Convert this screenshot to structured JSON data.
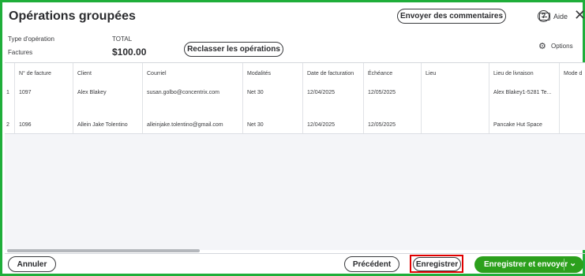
{
  "header": {
    "title": "Opérations groupées",
    "feedback_label": "Envoyer des commentaires",
    "help_glyph": "?",
    "help_label": "Aide",
    "close_glyph": "✕"
  },
  "summary": {
    "type_label": "Type d'opération",
    "type_value": "Factures",
    "total_label": "TOTAL",
    "total_value": "$100.00",
    "reclassify_label": "Reclasser les opérations",
    "options_label": "Options"
  },
  "table": {
    "columns": [
      "N° de facture",
      "Client",
      "Courriel",
      "Modalités",
      "Date de facturation",
      "Échéance",
      "Lieu",
      "Lieu de livraison",
      "Mode d"
    ],
    "rows": [
      {
        "num": "1",
        "cells": [
          "1097",
          "Alex Blakey",
          "susan.golbo@concentrix.com",
          "Net 30",
          "12/04/2025",
          "12/05/2025",
          "",
          "Alex Blakey1-5281 Te..."
        ]
      },
      {
        "num": "2",
        "cells": [
          "1096",
          "Allein Jake Tolentino",
          "alleinjake.tolentino@gmail.com",
          "Net 30",
          "12/04/2025",
          "12/05/2025",
          "",
          "Pancake Hut Space"
        ]
      }
    ]
  },
  "footer": {
    "cancel_label": "Annuler",
    "previous_label": "Précédent",
    "save_label": "Enregistrer",
    "save_send_label": "Enregistrer et envoyer",
    "chevron_glyph": "⌄"
  },
  "colors": {
    "frame_border": "#1fae3a",
    "primary_green": "#2ca01c",
    "highlight_red": "#e00000"
  }
}
